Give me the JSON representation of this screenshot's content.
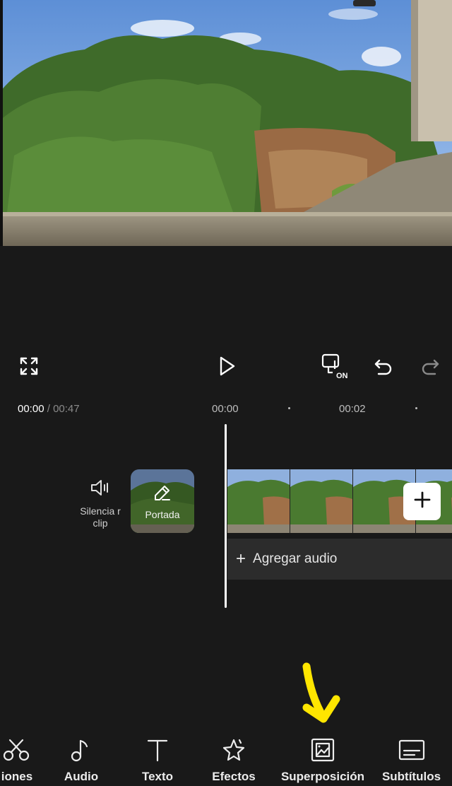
{
  "preview": {
    "image": "landscape-photo-hill-vegetation-wall"
  },
  "controls": {
    "fullscreen_icon": "fullscreen-expand-icon",
    "play_icon": "play-icon",
    "keyframe_icon": "keyframe-on-icon",
    "keyframe_badge": "ON",
    "undo_icon": "undo-icon",
    "redo_icon": "redo-icon"
  },
  "timeline": {
    "current_time": "00:00",
    "separator": " / ",
    "total_time": "00:47",
    "ticks": [
      "00:00",
      "00:02"
    ]
  },
  "track": {
    "mute_label": "Silencia r clip",
    "cover_label": "Portada",
    "add_clip_icon": "plus-icon",
    "add_audio_plus": "+",
    "add_audio_label": "Agregar audio"
  },
  "annotation": {
    "arrow_color": "#FFE600"
  },
  "toolbar": {
    "items": [
      {
        "label": "iones",
        "icon": "scissors-icon"
      },
      {
        "label": "Audio",
        "icon": "music-note-icon"
      },
      {
        "label": "Texto",
        "icon": "text-icon"
      },
      {
        "label": "Efectos",
        "icon": "effects-star-icon"
      },
      {
        "label": "Superposición",
        "icon": "overlay-image-icon"
      },
      {
        "label": "Subtítulos",
        "icon": "subtitles-icon"
      }
    ]
  },
  "colors": {
    "background": "#191919",
    "accent_white": "#FFFFFF",
    "audio_track": "#2C2C2C"
  }
}
